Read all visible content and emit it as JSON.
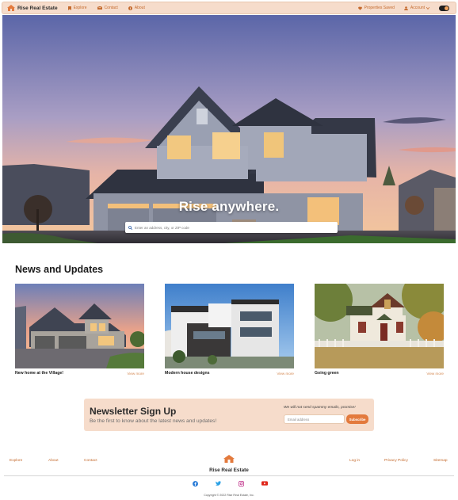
{
  "nav": {
    "brand": "Rise Real Estate",
    "links": [
      {
        "label": "Explore",
        "icon": "bookmark-icon"
      },
      {
        "label": "Contact",
        "icon": "mail-icon"
      },
      {
        "label": "About",
        "icon": "info-icon"
      }
    ],
    "saved_label": "Properties Saved",
    "account_label": "Account",
    "toggle_state": "on"
  },
  "hero": {
    "title": "Rise anywhere.",
    "search_placeholder": "Enter an address, city, or ZIP code"
  },
  "news": {
    "title": "News and Updates",
    "cards": [
      {
        "title": "New home at the Village!",
        "more": "View more"
      },
      {
        "title": "Modern house designs",
        "more": "View more"
      },
      {
        "title": "Going green",
        "more": "View more"
      }
    ]
  },
  "newsletter": {
    "title": "Newsletter Sign Up",
    "subtitle": "Be the first to know about the latest news and updates!",
    "note": "We will not send spammy emails, promise!",
    "email_placeholder": "Email address",
    "button": "Subscribe"
  },
  "footer": {
    "left_links": [
      "Explore",
      "About",
      "Contact"
    ],
    "brand": "Rise Real Estate",
    "right_links": [
      "Log in",
      "Privacy Policy",
      "Sitemap"
    ],
    "socials": [
      "facebook-icon",
      "twitter-icon",
      "instagram-icon",
      "youtube-icon"
    ],
    "copyright": "Copyright © 2022 Rise Real Estate, Inc."
  },
  "colors": {
    "accent": "#e37a3d",
    "nav_bg": "#f6dccb",
    "link": "#c46a2d"
  }
}
